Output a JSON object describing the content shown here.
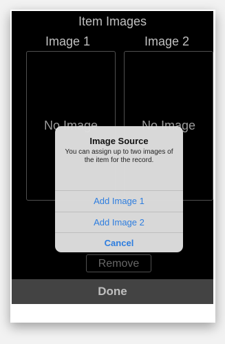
{
  "screen": {
    "title": "Item Images",
    "image1_label": "Image  1",
    "image2_label": "Image 2",
    "no_image_text": "No Image",
    "remove_label": "Remove",
    "done_label": "Done"
  },
  "alert": {
    "title": "Image Source",
    "message": "You can assign up to two images of the item for the record.",
    "actions": [
      "Add Image 1",
      "Add Image 2"
    ],
    "cancel_label": "Cancel"
  },
  "colors": {
    "background": "#000000",
    "alert_background": "#dfdfdf",
    "action_blue": "#2d7ddf",
    "done_bar": "#5a5a5a"
  }
}
